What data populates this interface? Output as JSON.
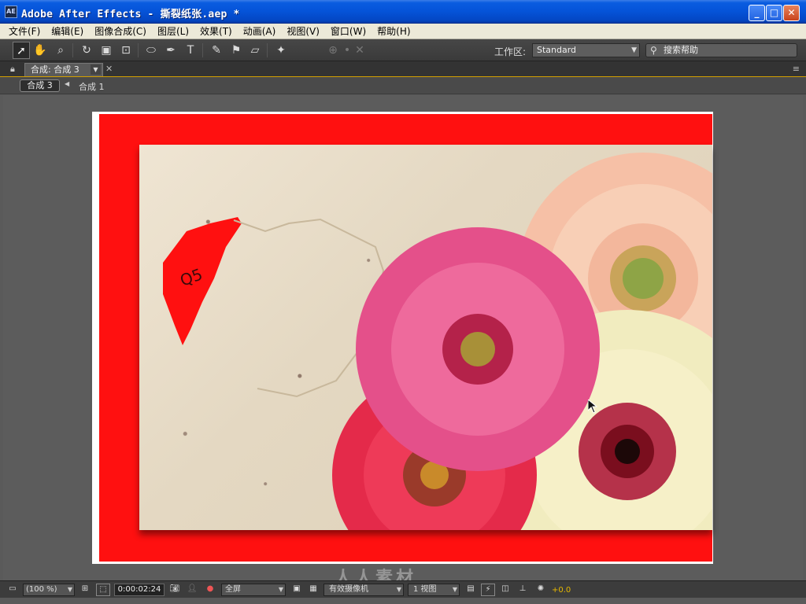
{
  "window": {
    "app_icon": "AE",
    "title": "Adobe After Effects - 撕裂纸张.aep *"
  },
  "menu": [
    "文件(F)",
    "编辑(E)",
    "图像合成(C)",
    "图层(L)",
    "效果(T)",
    "动画(A)",
    "视图(V)",
    "窗口(W)",
    "帮助(H)"
  ],
  "toolbar": {
    "tools": [
      "selection-tool",
      "hand-tool",
      "zoom-tool",
      "rotation-tool",
      "camera-tool",
      "pan-behind-tool",
      "ellipse-tool",
      "pen-tool",
      "type-tool",
      "brush-tool",
      "clone-stamp-tool",
      "eraser-tool",
      "puppet-pin-tool"
    ],
    "workspace_label": "工作区:",
    "workspace_value": "Standard",
    "search_placeholder": "搜索帮助"
  },
  "panel": {
    "tab_label": "合成: 合成 3"
  },
  "breadcrumb": {
    "active": "合成 3",
    "next": "合成 1"
  },
  "viewer": {
    "torn_paper_text": "Q5",
    "colors": {
      "background": "#5c5c5c",
      "frame": "#ffffff",
      "red_layer": "#ff1010",
      "paper": "#e7dcc8"
    }
  },
  "watermark": "人人素材",
  "viewer_controls": {
    "zoom": "(100 %)",
    "timecode": "0:00:02:24",
    "resolution": "全屏",
    "camera": "有效摄像机",
    "views": "1 视图",
    "exposure": "+0.0"
  }
}
